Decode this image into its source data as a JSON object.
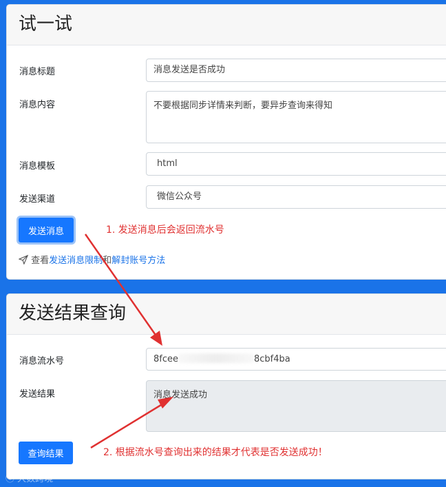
{
  "try_section": {
    "title": "试一试",
    "fields": [
      {
        "label": "消息标题",
        "value": "消息发送是否成功"
      },
      {
        "label": "消息内容",
        "value": "不要根据同步详情来判断，要异步查询来得知"
      },
      {
        "label": "消息模板",
        "value": "html"
      },
      {
        "label": "发送渠道",
        "value": "微信公众号"
      }
    ],
    "send_button": "发送消息",
    "help_prefix": "查看",
    "help_link1": "发送消息限制",
    "help_mid": "和",
    "help_link2": "解封账号方法",
    "icon": "send-icon"
  },
  "query_section": {
    "title": "发送结果查询",
    "serial_label": "消息流水号",
    "serial_value_left": "8fcee",
    "serial_value_right": "8cbf4ba",
    "result_label": "发送结果",
    "result_value": "消息发送成功",
    "query_button": "查询结果"
  },
  "annotations": {
    "step1": "1. 发送消息后会返回流水号",
    "step2": "2. 根据流水号查询出来的结果才代表是否发送成功！",
    "color": "#e03131"
  },
  "watermark": "大数跨境"
}
